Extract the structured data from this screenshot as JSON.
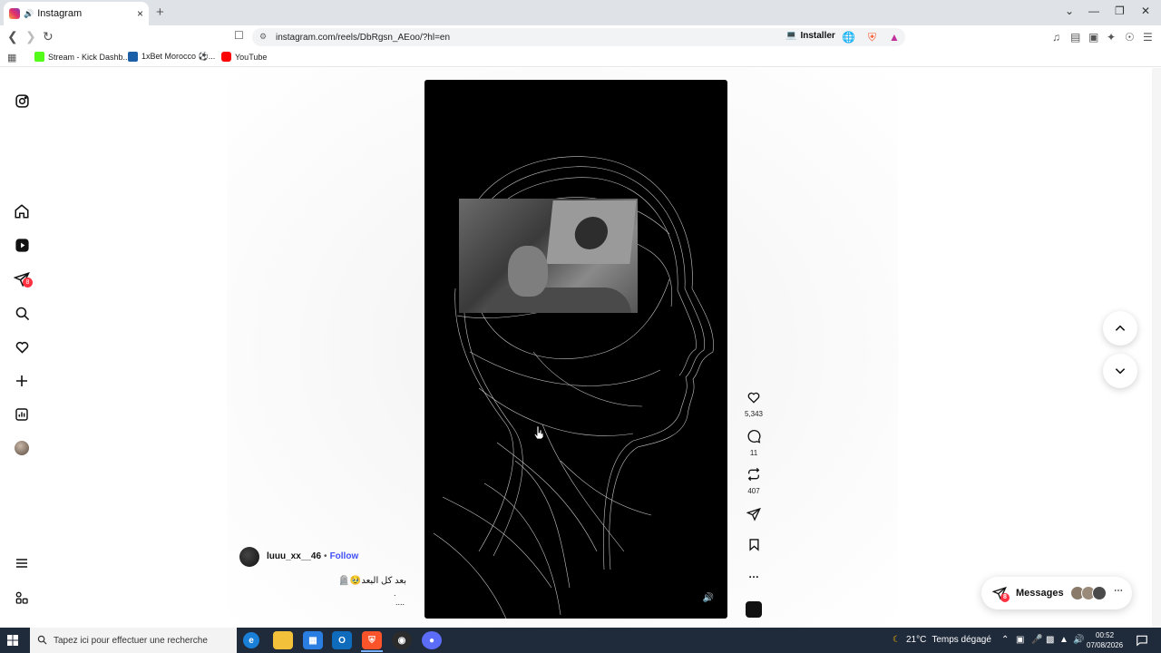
{
  "browser": {
    "tab_title": "Instagram",
    "url": "instagram.com/reels/DbRgsn_AEoo/?hl=en",
    "install_label": "Installer",
    "bookmarks": [
      {
        "label": "Stream - Kick Dashb...",
        "color": "#53fc18"
      },
      {
        "label": "1xBet Morocco ⚽...",
        "color": "#1b5fa8"
      },
      {
        "label": "YouTube",
        "color": "#ff0000"
      }
    ]
  },
  "sidebar": {
    "items": [
      {
        "name": "instagram",
        "icon": "instagram-icon"
      },
      {
        "name": "home",
        "icon": "home-icon"
      },
      {
        "name": "reels",
        "icon": "reels-icon"
      },
      {
        "name": "messages",
        "icon": "direct-icon",
        "badge": "8"
      },
      {
        "name": "search",
        "icon": "search-icon"
      },
      {
        "name": "notifications",
        "icon": "heart-icon"
      },
      {
        "name": "create",
        "icon": "plus-icon"
      },
      {
        "name": "dashboard",
        "icon": "chart-icon"
      },
      {
        "name": "profile",
        "icon": "avatar-icon"
      },
      {
        "name": "more",
        "icon": "menu-icon"
      },
      {
        "name": "also-from-meta",
        "icon": "grid-icon"
      }
    ]
  },
  "reel": {
    "username": "luuu_xx__46",
    "separator": "•",
    "follow_label": "Follow",
    "caption": "بعد كل البعد🥹🪦",
    "caption_line2": ".",
    "caption_more": "....",
    "likes": "5,343",
    "comments": "11",
    "reposts": "407"
  },
  "messages_widget": {
    "label": "Messages",
    "badge": "8",
    "avatar_colors": [
      "#8a7a6a",
      "#9a8a7a",
      "#4a4a4a"
    ]
  },
  "taskbar": {
    "search_placeholder": "Tapez ici pour effectuer une recherche",
    "weather_temp": "21°C",
    "weather_text": "Temps dégagé",
    "time": "00:52",
    "date": "07/08/2026"
  },
  "colors": {
    "follow": "#4150f7",
    "badge": "#ff3040",
    "taskbar": "#1f2a3a"
  }
}
